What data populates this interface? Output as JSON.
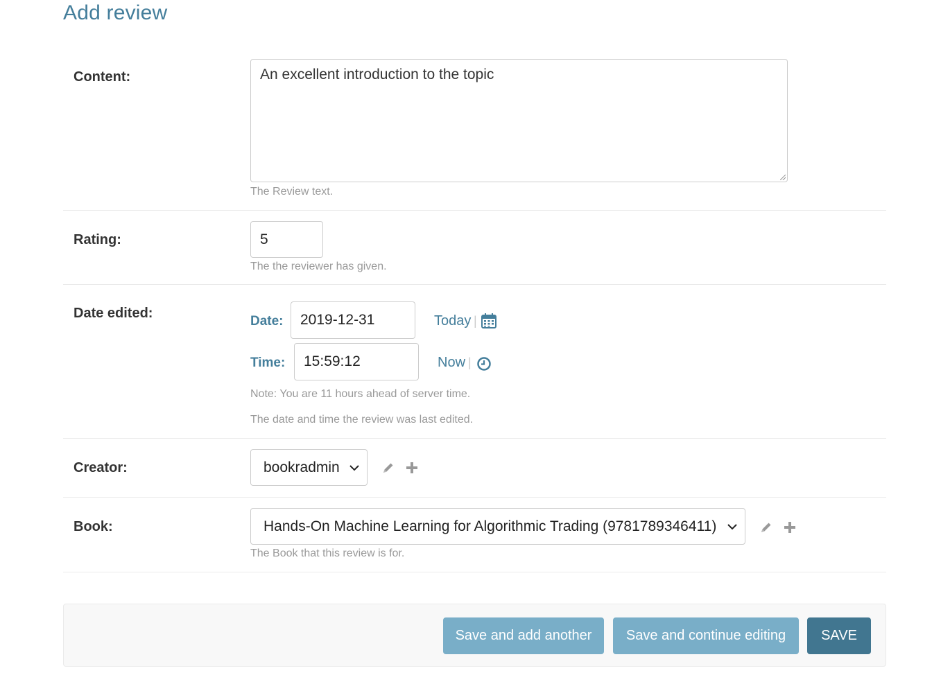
{
  "page": {
    "title": "Add review"
  },
  "content": {
    "label": "Content:",
    "value": "An excellent introduction to the topic",
    "help": "The Review text."
  },
  "rating": {
    "label": "Rating:",
    "value": "5",
    "help": "The the reviewer has given."
  },
  "date_edited": {
    "label": "Date edited:",
    "date_label": "Date:",
    "date_value": "2019-12-31",
    "today_link": "Today",
    "time_label": "Time:",
    "time_value": "15:59:12",
    "now_link": "Now",
    "separator": "|",
    "timezone_note": "Note: You are 11 hours ahead of server time.",
    "help": "The date and time the review was last edited."
  },
  "creator": {
    "label": "Creator:",
    "selected": "bookradmin"
  },
  "book": {
    "label": "Book:",
    "selected": "Hands-On Machine Learning for Algorithmic Trading (9781789346411)",
    "help": "The Book that this review is for."
  },
  "actions": {
    "save_add_another": "Save and add another",
    "save_continue": "Save and continue editing",
    "save": "SAVE"
  },
  "colors": {
    "accent": "#447e9b",
    "button_secondary": "#79aec8",
    "button_primary": "#417690",
    "help_text": "#999999"
  },
  "icons": [
    "calendar-icon",
    "clock-icon",
    "pencil-icon",
    "plus-icon",
    "chevron-down-icon"
  ]
}
